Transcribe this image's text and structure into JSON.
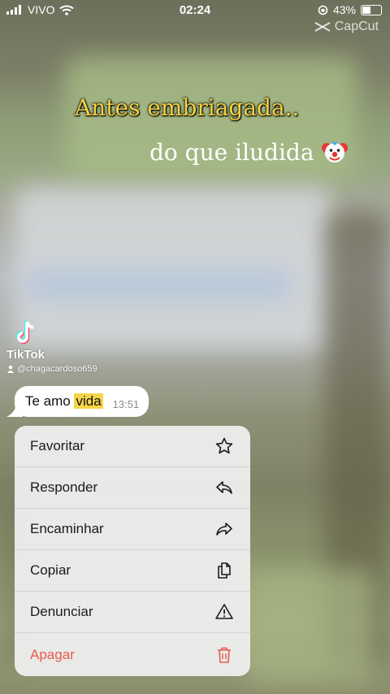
{
  "status_bar": {
    "carrier": "VIVO",
    "time": "02:24",
    "battery": "43%",
    "battery_level": 0.43
  },
  "watermark": "CapCut",
  "captions": {
    "line1": "Antes embriagada..",
    "line2": "do que iludida"
  },
  "tiktok": {
    "brand": "TikTok",
    "username": "@chagacardoso659"
  },
  "message": {
    "text_before": "Te amo ",
    "highlight": "vida",
    "time": "13:51"
  },
  "context_menu": {
    "items": [
      {
        "label": "Favoritar",
        "icon": "star-icon"
      },
      {
        "label": "Responder",
        "icon": "reply-icon"
      },
      {
        "label": "Encaminhar",
        "icon": "forward-icon"
      },
      {
        "label": "Copiar",
        "icon": "copy-icon"
      },
      {
        "label": "Denunciar",
        "icon": "warning-icon"
      },
      {
        "label": "Apagar",
        "icon": "trash-icon",
        "color": "#e85a4f"
      }
    ]
  }
}
